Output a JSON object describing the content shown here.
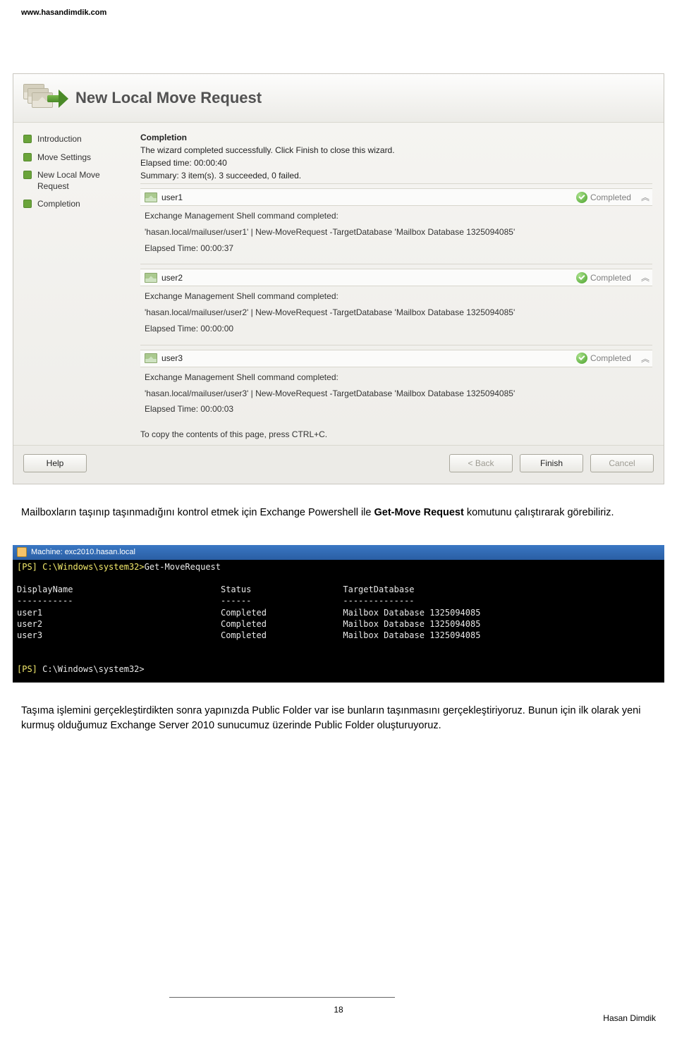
{
  "header": {
    "site": "www.hasandimdik.com"
  },
  "wizard": {
    "title": "New Local Move Request",
    "nav": [
      {
        "label": "Introduction"
      },
      {
        "label": "Move Settings"
      },
      {
        "label": "New Local Move Request"
      },
      {
        "label": "Completion"
      }
    ],
    "completion": {
      "heading": "Completion",
      "line1": "The wizard completed successfully. Click Finish to close this wizard.",
      "elapsed": "Elapsed time: 00:00:40",
      "summary": "Summary: 3 item(s). 3 succeeded, 0 failed."
    },
    "items": [
      {
        "name": "user1",
        "status": "Completed",
        "cmdline": "Exchange Management Shell command completed:",
        "cmd": "'hasan.local/mailuser/user1' | New-MoveRequest -TargetDatabase 'Mailbox Database 1325094085'",
        "elapsed": "Elapsed Time: 00:00:37"
      },
      {
        "name": "user2",
        "status": "Completed",
        "cmdline": "Exchange Management Shell command completed:",
        "cmd": "'hasan.local/mailuser/user2' | New-MoveRequest -TargetDatabase 'Mailbox Database 1325094085'",
        "elapsed": "Elapsed Time: 00:00:00"
      },
      {
        "name": "user3",
        "status": "Completed",
        "cmdline": "Exchange Management Shell command completed:",
        "cmd": "'hasan.local/mailuser/user3' | New-MoveRequest -TargetDatabase 'Mailbox Database 1325094085'",
        "elapsed": "Elapsed Time: 00:00:03"
      }
    ],
    "copy_hint": "To copy the contents of this page, press CTRL+C.",
    "buttons": {
      "help": "Help",
      "back": "< Back",
      "finish": "Finish",
      "cancel": "Cancel"
    }
  },
  "paragraph1": {
    "pre": "Mailboxların taşınıp taşınmadığını kontrol etmek için Exchange Powershell ile ",
    "bold": "Get-Move Request",
    "post": " komutunu çalıştırarak görebiliriz."
  },
  "console": {
    "title": "Machine: exc2010.hasan.local",
    "prompt1_a": "[PS] ",
    "prompt1_b": "C:\\Windows\\system32>",
    "cmd": "Get-MoveRequest",
    "cols": {
      "c1": "DisplayName",
      "c2": "Status",
      "c3": "TargetDatabase"
    },
    "sep": {
      "c1": "-----------",
      "c2": "------",
      "c3": "--------------"
    },
    "rows": [
      {
        "c1": "user1",
        "c2": "Completed",
        "c3": "Mailbox Database 1325094085"
      },
      {
        "c1": "user2",
        "c2": "Completed",
        "c3": "Mailbox Database 1325094085"
      },
      {
        "c1": "user3",
        "c2": "Completed",
        "c3": "Mailbox Database 1325094085"
      }
    ],
    "prompt2_a": "[PS] ",
    "prompt2_b": "C:\\Windows\\system32>"
  },
  "paragraph2": "Taşıma işlemini gerçekleştirdikten sonra yapınızda Public Folder var ise bunların taşınmasını gerçekleştiriyoruz. Bunun için ilk olarak yeni kurmuş olduğumuz Exchange Server 2010 sunucumuz üzerinde Public Folder oluşturuyoruz.",
  "footer": {
    "page": "18",
    "author": "Hasan Dimdik"
  }
}
